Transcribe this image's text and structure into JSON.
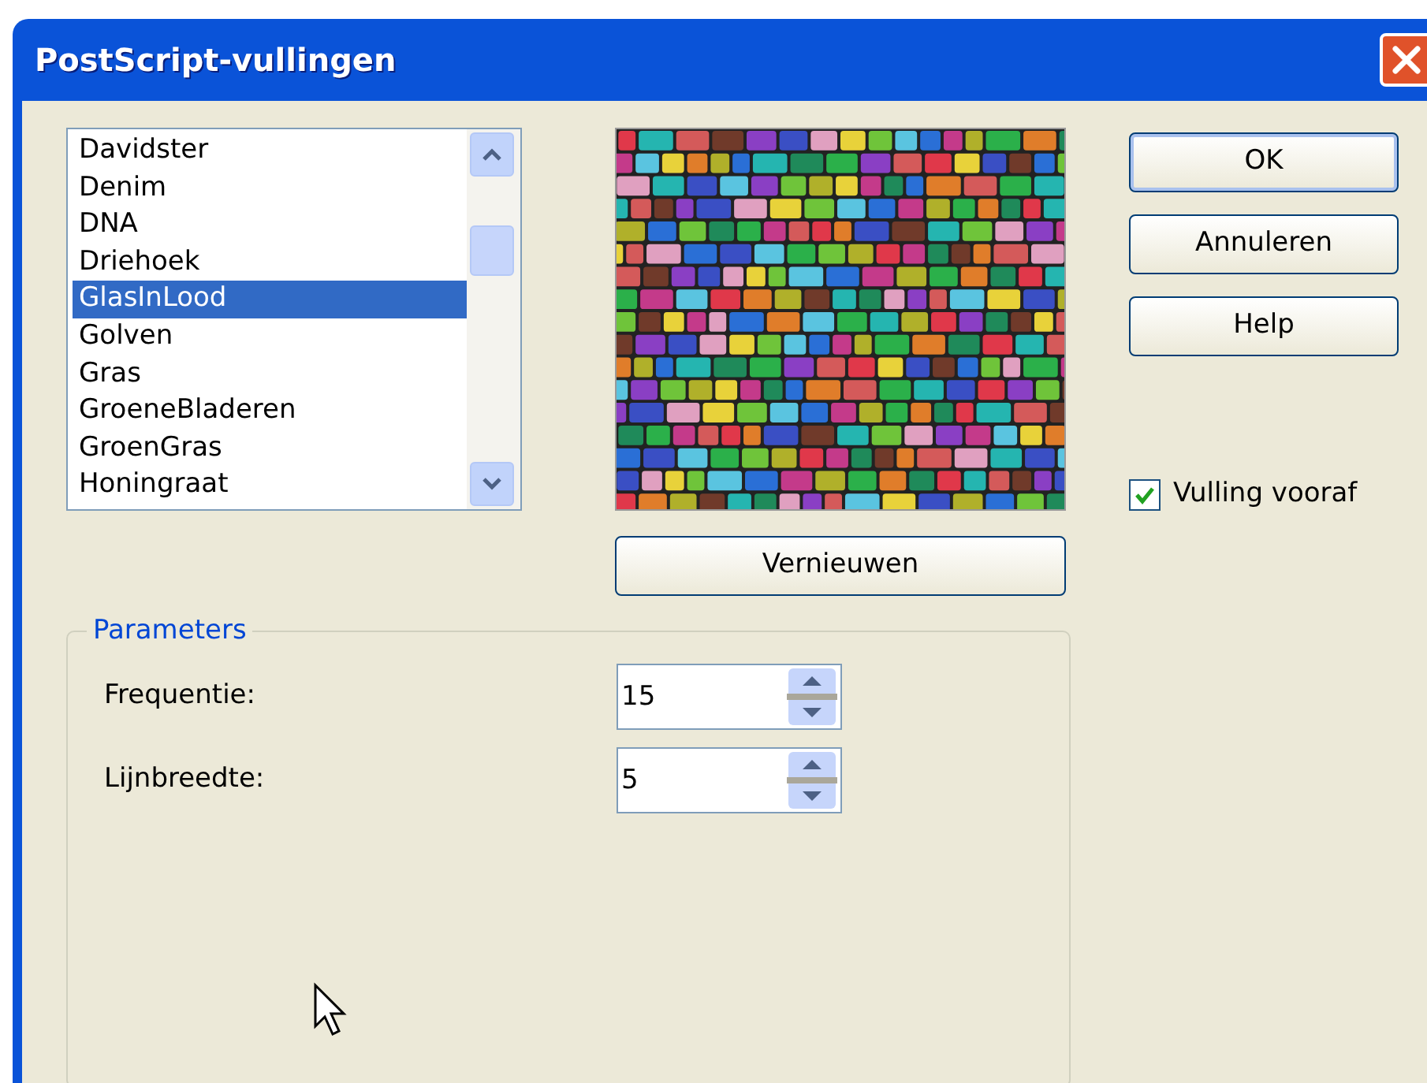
{
  "window": {
    "title": "PostScript-vullingen"
  },
  "fill_list": {
    "items": [
      {
        "label": "Davidster",
        "selected": false
      },
      {
        "label": "Denim",
        "selected": false
      },
      {
        "label": "DNA",
        "selected": false
      },
      {
        "label": "Driehoek",
        "selected": false
      },
      {
        "label": "GlasInLood",
        "selected": true
      },
      {
        "label": "Golven",
        "selected": false
      },
      {
        "label": "Gras",
        "selected": false
      },
      {
        "label": "GroeneBladeren",
        "selected": false
      },
      {
        "label": "GroenGras",
        "selected": false
      },
      {
        "label": "Honingraat",
        "selected": false
      }
    ]
  },
  "refresh_button": "Vernieuwen",
  "buttons": [
    {
      "label": "OK",
      "default": true
    },
    {
      "label": "Annuleren",
      "default": false
    },
    {
      "label": "Help",
      "default": false
    }
  ],
  "preview_checkbox": {
    "label": "Vulling vooraf",
    "checked": true
  },
  "parameters": {
    "title": "Parameters",
    "fields": [
      {
        "label": "Frequentie:",
        "value": "15"
      },
      {
        "label": "Lijnbreedte:",
        "value": "5"
      }
    ]
  }
}
